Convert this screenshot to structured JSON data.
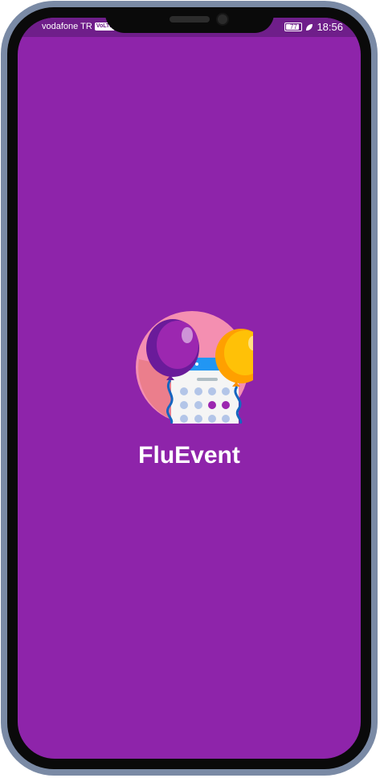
{
  "status_bar": {
    "carrier": "vodafone TR",
    "network_badge": "VoLTE",
    "battery_level": "77",
    "time": "18:56"
  },
  "splash": {
    "app_name": "FluEvent",
    "logo_icon": "calendar-balloons-icon"
  },
  "colors": {
    "background": "#8e24aa",
    "status_bar": "#6f1e8a",
    "frame": "#7a8aa5"
  }
}
